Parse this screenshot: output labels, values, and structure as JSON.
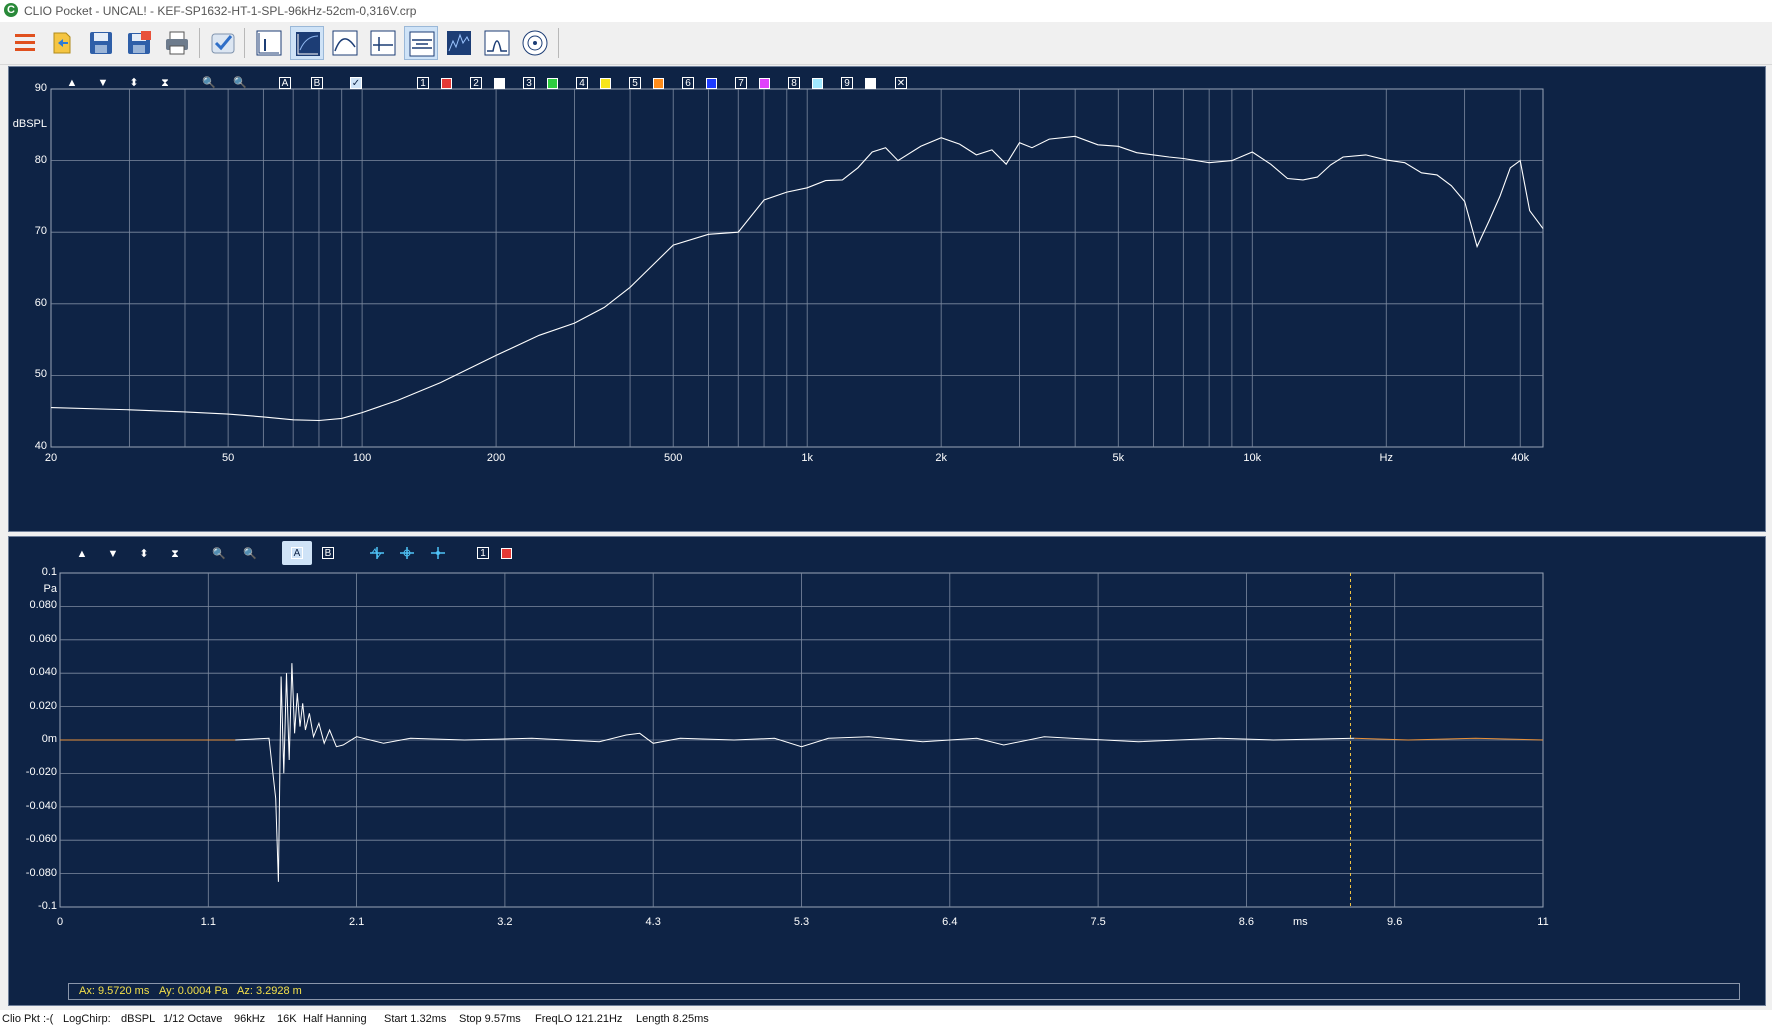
{
  "window": {
    "title": "CLIO Pocket - UNCAL! - KEF-SP1632-HT-1-SPL-96kHz-52cm-0,316V.crp",
    "app_icon": "C"
  },
  "toolbar": {
    "buttons": [
      {
        "name": "menu-button",
        "icon": "menu-icon"
      },
      {
        "name": "open-button",
        "icon": "open-folder-icon"
      },
      {
        "name": "save-button",
        "icon": "save-icon"
      },
      {
        "name": "save-as-button",
        "icon": "save-as-icon"
      },
      {
        "name": "print-button",
        "icon": "printer-icon"
      },
      {
        "name": "check-button",
        "icon": "checkmark-icon"
      },
      {
        "name": "mode-1-button",
        "icon": "impulse-icon"
      },
      {
        "name": "mode-2-button",
        "icon": "sweep-icon"
      },
      {
        "name": "mode-3-button",
        "icon": "curve-icon"
      },
      {
        "name": "mode-4-button",
        "icon": "cross-icon"
      },
      {
        "name": "mode-5-button",
        "icon": "step-icon"
      },
      {
        "name": "mode-6-button",
        "icon": "waterfall-icon"
      },
      {
        "name": "mode-7-button",
        "icon": "peak-icon"
      },
      {
        "name": "mode-8-button",
        "icon": "polar-icon"
      }
    ],
    "active": [
      "mode-2-button",
      "mode-5-button"
    ]
  },
  "freq_panel": {
    "tools": [
      "▲",
      "▼",
      "⬍",
      "⧗"
    ],
    "zoom_in": "🔍",
    "zoom_out": "🔍",
    "cursor_a": "A",
    "cursor_b": "B",
    "overlays": [
      {
        "num": "1",
        "color": "#e53935"
      },
      {
        "num": "2",
        "color": "#ffffff"
      },
      {
        "num": "3",
        "color": "#2ecc40"
      },
      {
        "num": "4",
        "color": "#f7e51a"
      },
      {
        "num": "5",
        "color": "#ff8c1a"
      },
      {
        "num": "6",
        "color": "#1e3cff"
      },
      {
        "num": "7",
        "color": "#e040fb"
      },
      {
        "num": "8",
        "color": "#a0e8ff"
      },
      {
        "num": "9",
        "color": "#ffffff"
      }
    ],
    "clear_label": "✕"
  },
  "time_panel": {
    "tools": [
      "▲",
      "▼",
      "⬍",
      "⧗"
    ],
    "zoom_in": "🔍",
    "zoom_out": "🔍",
    "cursor_a": "A",
    "cursor_b": "B",
    "marker_icons": [
      "marker-1-icon",
      "marker-2-icon",
      "marker-3-icon"
    ],
    "overlay": {
      "num": "1",
      "color": "#e53935"
    }
  },
  "chart_data": [
    {
      "type": "line",
      "x_scale": "log",
      "xlim": [
        20,
        45000
      ],
      "ylim": [
        40,
        90
      ],
      "ylabel": "dBSPL",
      "xlabel": "Hz",
      "y_ticks": [
        "90",
        "dBSPL",
        "80",
        "70",
        "60",
        "50",
        "40"
      ],
      "x_ticks": [
        "20",
        "50",
        "100",
        "200",
        "500",
        "1k",
        "2k",
        "5k",
        "10k",
        "Hz",
        "40k"
      ],
      "grid": true,
      "color": "#ffffff",
      "series": [
        {
          "x": [
            20,
            30,
            40,
            50,
            60,
            70,
            80,
            90,
            100,
            120,
            150,
            200,
            250,
            300,
            350,
            400,
            500,
            600,
            700,
            800,
            900,
            1000,
            1100,
            1200,
            1300,
            1400,
            1500,
            1600,
            1800,
            2000,
            2200,
            2400,
            2600,
            2800,
            3000,
            3200,
            3500,
            4000,
            4500,
            5000,
            5500,
            6000,
            6500,
            7000,
            8000,
            9000,
            10000,
            11000,
            12000,
            13000,
            14000,
            15000,
            16000,
            18000,
            20000,
            22000,
            24000,
            26000,
            28000,
            30000,
            32000,
            34000,
            36000,
            38000,
            40000,
            42000,
            45000
          ],
          "y": [
            45.5,
            45.2,
            44.9,
            44.6,
            44.2,
            43.8,
            43.7,
            44.0,
            44.8,
            46.5,
            49.0,
            52.8,
            55.6,
            57.3,
            59.5,
            62.3,
            68.2,
            69.7,
            70.0,
            74.5,
            75.6,
            76.2,
            77.2,
            77.3,
            79.0,
            81.2,
            81.8,
            80.0,
            82.0,
            83.2,
            82.3,
            80.8,
            81.5,
            79.5,
            82.5,
            81.8,
            83.0,
            83.4,
            82.2,
            82.0,
            81.1,
            80.8,
            80.5,
            80.3,
            79.7,
            80.0,
            81.2,
            79.5,
            77.5,
            77.3,
            77.7,
            79.4,
            80.5,
            80.8,
            80.1,
            79.7,
            78.3,
            78.0,
            76.5,
            74.3,
            68.0,
            71.5,
            75.0,
            79.0,
            80.0,
            73.0,
            70.5
          ]
        }
      ]
    },
    {
      "type": "line",
      "xlim": [
        0,
        11
      ],
      "ylim": [
        -0.1,
        0.1
      ],
      "xlabel": "ms",
      "ylabel": "Pa",
      "y_ticks": [
        "0.1",
        "Pa",
        "0.080",
        "0.060",
        "0.040",
        "0.020",
        "0m",
        "-0.020",
        "-0.040",
        "-0.060",
        "-0.080",
        "-0.1"
      ],
      "x_ticks": [
        "0",
        "1.1",
        "2.1",
        "3.2",
        "4.3",
        "5.3",
        "6.4",
        "7.5",
        "8.6",
        "ms",
        "9.6",
        "11"
      ],
      "grid": true,
      "window_color": "#ffffff",
      "outside_color": "#e8913a",
      "window": {
        "start": 1.32,
        "stop": 9.57
      },
      "cursor_ms": 9.572,
      "series": [
        {
          "x": [
            0,
            0.5,
            1.0,
            1.3,
            1.55,
            1.6,
            1.62,
            1.64,
            1.66,
            1.68,
            1.7,
            1.72,
            1.74,
            1.76,
            1.78,
            1.8,
            1.82,
            1.85,
            1.88,
            1.92,
            1.96,
            2.0,
            2.05,
            2.1,
            2.2,
            2.4,
            2.6,
            3.0,
            3.5,
            4.0,
            4.2,
            4.3,
            4.4,
            4.6,
            5.0,
            5.3,
            5.5,
            5.7,
            6.0,
            6.4,
            6.8,
            7.0,
            7.3,
            7.5,
            8.0,
            8.6,
            9.0,
            9.6,
            10.0,
            10.5,
            11.0
          ],
          "y": [
            0,
            0,
            0,
            0,
            0.001,
            -0.035,
            -0.085,
            0.038,
            -0.02,
            0.04,
            -0.012,
            0.046,
            0.004,
            0.028,
            0.008,
            0.022,
            0.006,
            0.016,
            0.002,
            0.01,
            -0.002,
            0.006,
            -0.004,
            -0.003,
            0.002,
            -0.002,
            0.001,
            0,
            0.001,
            -0.001,
            0.003,
            0.004,
            -0.002,
            0.001,
            0,
            0.001,
            -0.004,
            0.001,
            0.002,
            -0.001,
            0.001,
            -0.003,
            0.002,
            0.001,
            -0.001,
            0.001,
            0,
            0.001,
            0,
            0.001,
            0
          ]
        }
      ]
    }
  ],
  "marker_bar": {
    "ax": "Ax: 9.5720 ms",
    "ay": "Ay: 0.0004 Pa",
    "az": "Az: 3.2928 m"
  },
  "status": {
    "items": [
      "Clio Pkt :-(",
      "LogChirp:",
      "dBSPL",
      "1/12 Octave",
      "96kHz",
      "16K",
      "Half Hanning",
      "Start 1.32ms",
      "Stop 9.57ms",
      "FreqLO 121.21Hz",
      "Length 8.25ms"
    ]
  }
}
